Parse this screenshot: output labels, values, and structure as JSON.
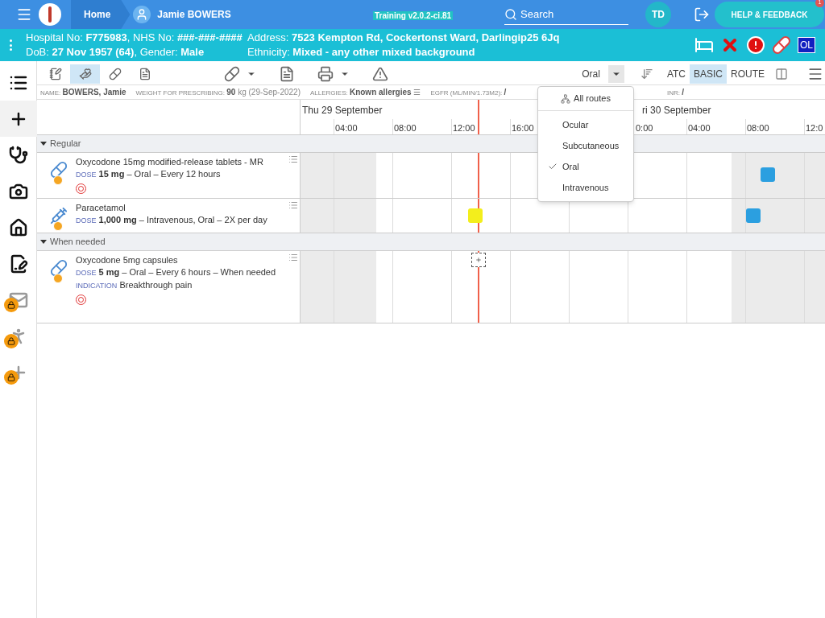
{
  "topbar": {
    "home": "Home",
    "patient": "Jamie BOWERS",
    "build": "Training v2.0.2-ci.81",
    "search": "Search",
    "user": "TD",
    "help": "HELP & FEEDBACK",
    "help_badge": "1"
  },
  "banner": {
    "line1": "Hospital No: **F775983**, NHS No: **###-###-####**",
    "line2": "DoB: **27 Nov 1957 (64)**, Gender: **Male**",
    "line3": "Address: **7523 Kempton Rd, Cockertonst Ward, Darlingip25 6Jq**",
    "line4": "Ethnicity: **Mixed - any other mixed background**",
    "flag": "OL"
  },
  "sidebar": {
    "items": [
      {
        "kind": "list",
        "selected": false,
        "locked": false
      },
      {
        "kind": "add",
        "selected": true,
        "locked": false
      },
      {
        "kind": "stethoscope",
        "selected": false,
        "locked": false
      },
      {
        "kind": "camera",
        "selected": false,
        "locked": false
      },
      {
        "kind": "home",
        "selected": false,
        "locked": false
      },
      {
        "kind": "sign",
        "selected": false,
        "locked": false
      },
      {
        "kind": "mail",
        "selected": false,
        "locked": true
      },
      {
        "kind": "walk",
        "selected": false,
        "locked": true
      },
      {
        "kind": "add",
        "selected": false,
        "locked": true
      }
    ]
  },
  "toolbar": {
    "views": [
      {
        "kind": "chart",
        "selected": false
      },
      {
        "kind": "hand",
        "selected": true
      },
      {
        "kind": "pill",
        "selected": false
      },
      {
        "kind": "doc",
        "selected": false
      }
    ],
    "route_filter": "Oral",
    "modes": [
      {
        "label": "ATC",
        "selected": false
      },
      {
        "label": "BASIC",
        "selected": true
      },
      {
        "label": "ROUTE",
        "selected": false
      }
    ]
  },
  "info": [
    {
      "label": "NAME:",
      "value": "BOWERS, Jamie"
    },
    {
      "label": "WEIGHT FOR PRESCRIBING:",
      "value": "90",
      "extra": "kg (29-Sep-2022)"
    },
    {
      "label": "ALLERGIES:",
      "value": "Known allergies",
      "extra": "☰"
    },
    {
      "label": "EGFR (ML/MIN/1.73M2):",
      "value": "/"
    },
    {
      "label": "INR:",
      "value": "/"
    }
  ],
  "timeline": {
    "days": [
      "Thu 29 September",
      "ri 30 September"
    ],
    "ticks": [
      "04:00",
      "08:00",
      "12:00",
      "16:00",
      "0:00",
      "04:00",
      "08:00",
      "12:0"
    ]
  },
  "groups": [
    {
      "title": "Regular",
      "expanded": true,
      "meds": [
        {
          "name": "Oxycodone 15mg modified-release tablets - MR",
          "dose_label": "DOSE",
          "dose": "15 mg",
          "detail": "– Oral – Every 12 hours",
          "controlled": true,
          "doses": [
            {
              "color": "#2b9fe0"
            }
          ]
        },
        {
          "name": "Paracetamol",
          "dose_label": "DOSE",
          "dose": "1,000 mg",
          "detail": "– Intravenous, Oral – 2X per day",
          "controlled": false,
          "doses": [
            {
              "color": "#f3ee1c"
            },
            {
              "color": "#2b9fe0"
            }
          ]
        }
      ]
    },
    {
      "title": "When needed",
      "expanded": true,
      "meds": [
        {
          "name": "Oxycodone 5mg capsules",
          "dose_label": "DOSE",
          "dose": "5 mg",
          "detail": "– Oral – Every 6 hours – When needed",
          "controlled": true,
          "indication_label": "INDICATION",
          "indication": "Breakthrough pain"
        }
      ]
    }
  ],
  "route_menu": {
    "all": "All routes",
    "items": [
      {
        "label": "Ocular",
        "selected": false
      },
      {
        "label": "Subcutaneous",
        "selected": false
      },
      {
        "label": "Oral",
        "selected": true
      },
      {
        "label": "Intravenous",
        "selected": false
      }
    ]
  }
}
